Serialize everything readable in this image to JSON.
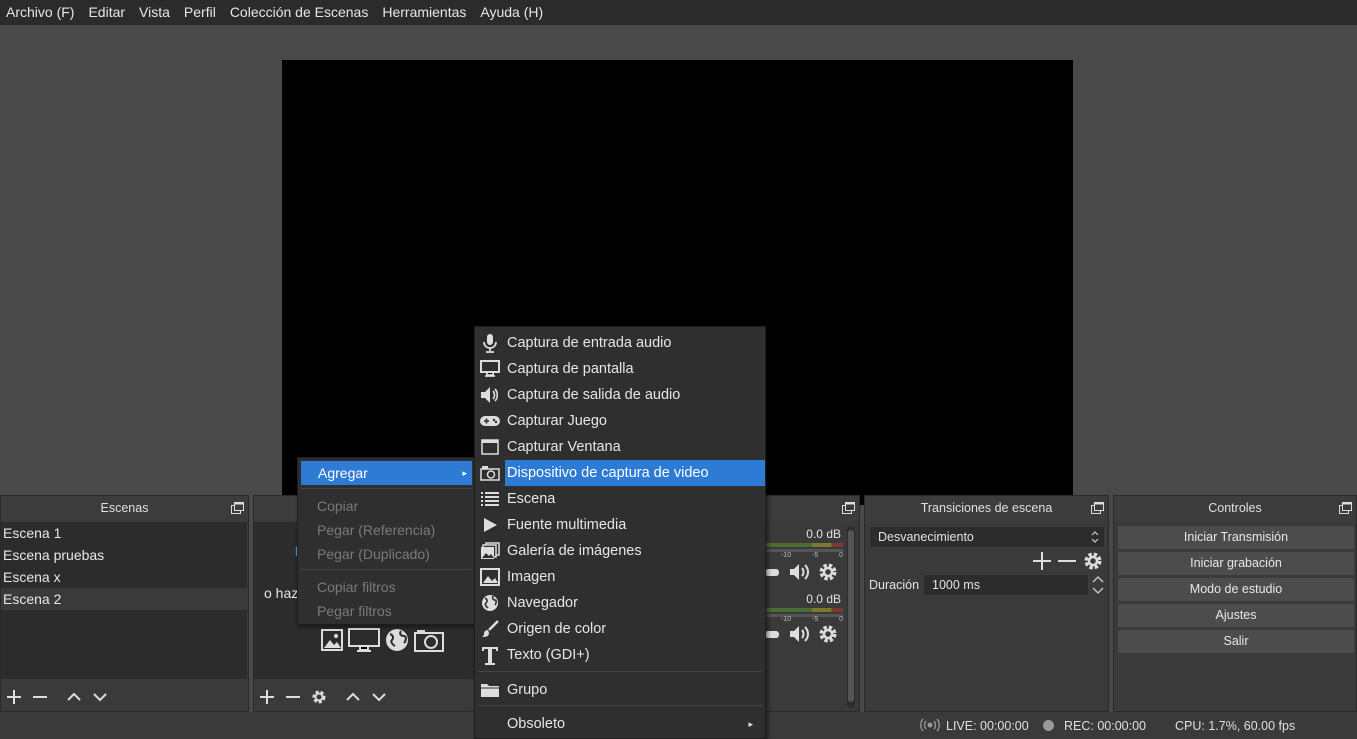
{
  "menubar": [
    "Archivo (F)",
    "Editar",
    "Vista",
    "Perfil",
    "Colección de Escenas",
    "Herramientas",
    "Ayuda (H)"
  ],
  "scenes": {
    "title": "Escenas",
    "items": [
      "Escena 1",
      "Escena pruebas",
      "Escena x",
      "Escena 2"
    ],
    "selected_index": 3
  },
  "sources": {
    "partial_hint": "o haz",
    "partial_char": "l"
  },
  "context_menu": {
    "agregar": "Agregar",
    "items": [
      "Copiar",
      "Pegar (Referencia)",
      "Pegar (Duplicado)",
      "Copiar filtros",
      "Pegar filtros"
    ]
  },
  "submenu": {
    "items": [
      {
        "label": "Captura de entrada audio",
        "icon": "microphone-icon"
      },
      {
        "label": "Captura de pantalla",
        "icon": "monitor-icon"
      },
      {
        "label": "Captura de salida de audio",
        "icon": "speaker-icon"
      },
      {
        "label": "Capturar Juego",
        "icon": "gamepad-icon"
      },
      {
        "label": "Capturar Ventana",
        "icon": "window-icon"
      },
      {
        "label": "Dispositivo de captura de video",
        "icon": "camera-icon"
      },
      {
        "label": "Escena",
        "icon": "list-icon"
      },
      {
        "label": "Fuente multimedia",
        "icon": "play-icon"
      },
      {
        "label": "Galería de imágenes",
        "icon": "gallery-icon"
      },
      {
        "label": "Imagen",
        "icon": "image-icon"
      },
      {
        "label": "Navegador",
        "icon": "globe-icon"
      },
      {
        "label": "Origen de color",
        "icon": "brush-icon"
      },
      {
        "label": "Texto (GDI+)",
        "icon": "text-icon"
      }
    ],
    "group": "Grupo",
    "obsolete": "Obsoleto",
    "highlight_index": 5,
    "highlight_color": "#2d7bd4"
  },
  "mixer": {
    "channels": [
      {
        "db": "0.0 dB",
        "scale": [
          "-10",
          "-5",
          "0"
        ]
      },
      {
        "db": "0.0 dB",
        "scale": [
          "-10",
          "-5",
          "0"
        ]
      }
    ]
  },
  "transitions": {
    "title": "Transiciones de escena",
    "selected": "Desvanecimiento",
    "duration_label": "Duración",
    "duration_value": "1000 ms"
  },
  "controls": {
    "title": "Controles",
    "buttons": [
      "Iniciar Transmisión",
      "Iniciar grabación",
      "Modo de estudio",
      "Ajustes",
      "Salir"
    ]
  },
  "status": {
    "live": "LIVE: 00:00:00",
    "rec": "REC: 00:00:00",
    "cpu": "CPU: 1.7%, 60.00 fps"
  }
}
